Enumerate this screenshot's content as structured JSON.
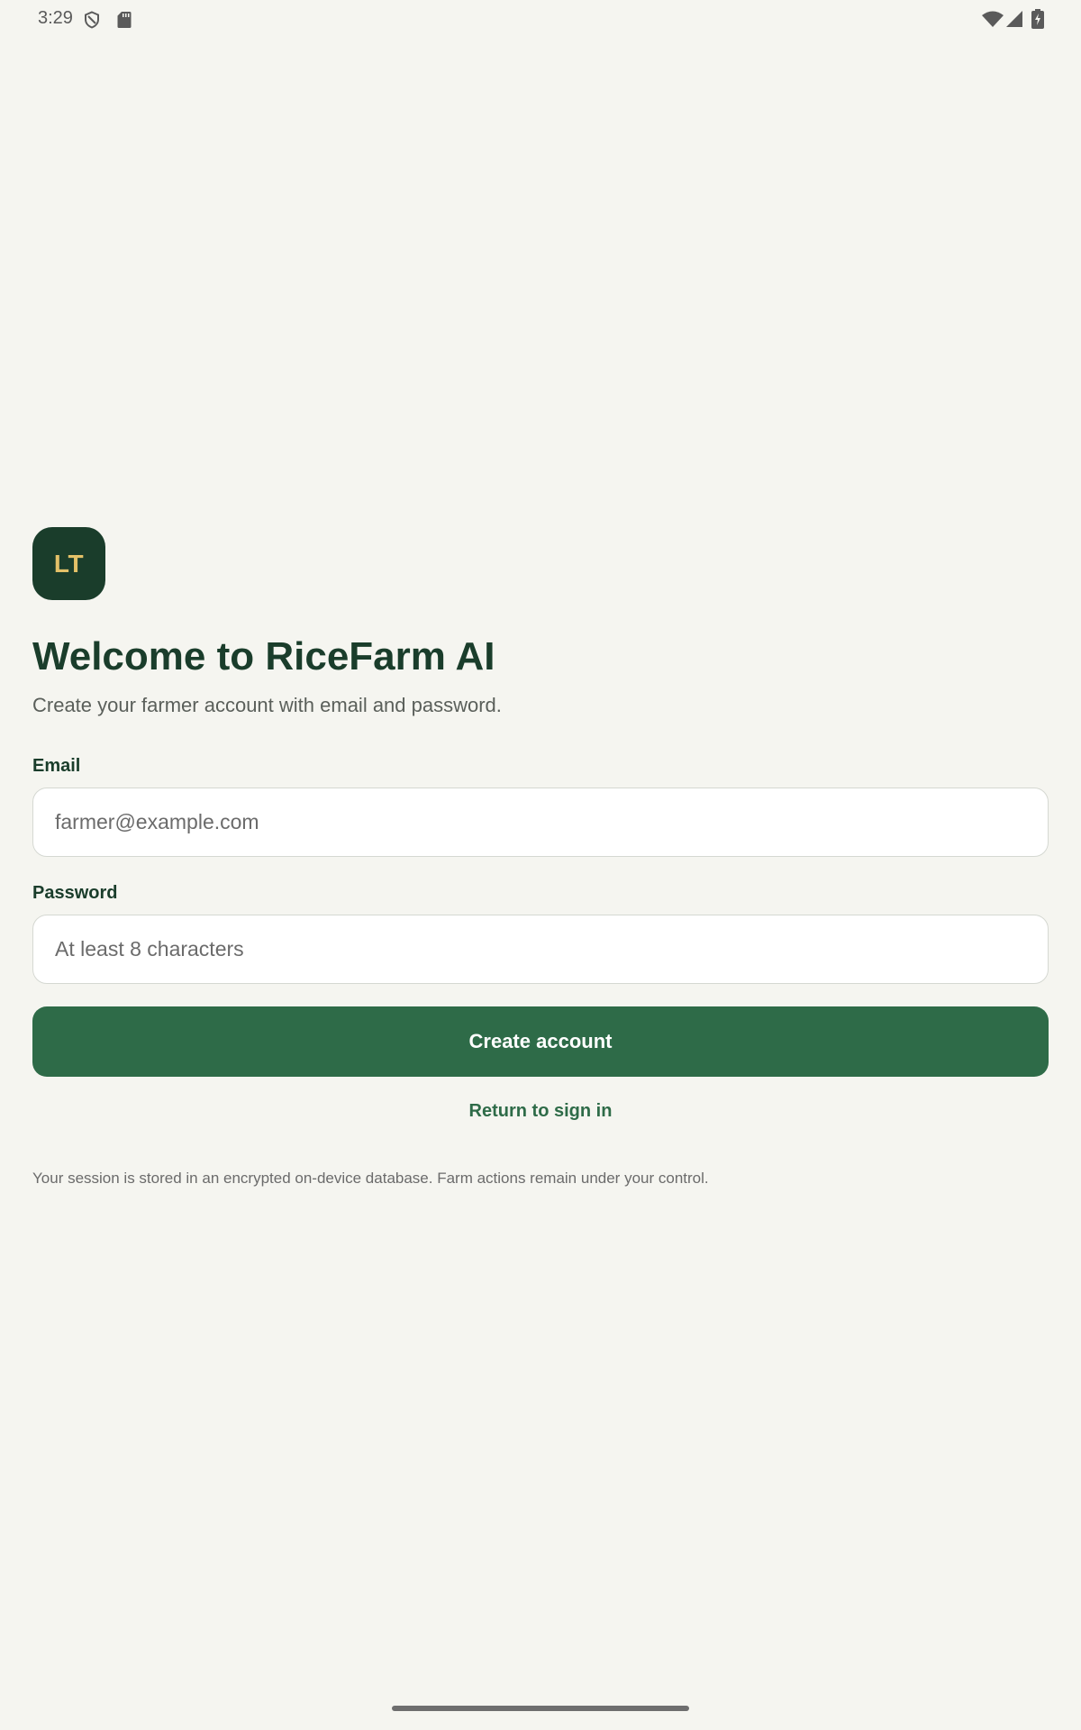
{
  "status_bar": {
    "time": "3:29",
    "left_icons": [
      "shield-icon",
      "sd-card-icon"
    ],
    "right_icons": [
      "wifi-icon",
      "cell-signal-icon",
      "battery-charging-icon"
    ]
  },
  "logo": {
    "initials": "LT",
    "background_color": "#1a3d2b",
    "text_color": "#e3c168"
  },
  "header": {
    "title": "Welcome to RiceFarm AI",
    "subtitle": "Create your farmer account with email and password."
  },
  "form": {
    "email": {
      "label": "Email",
      "placeholder": "farmer@example.com",
      "value": ""
    },
    "password": {
      "label": "Password",
      "placeholder": "At least 8 characters",
      "value": ""
    },
    "submit_label": "Create account",
    "return_label": "Return to sign in"
  },
  "footnote": "Your session is stored in an encrypted on-device database. Farm actions remain under your control.",
  "colors": {
    "accent": "#2e6b48",
    "dark_green": "#1a3d2b",
    "background": "#f5f5f0"
  }
}
